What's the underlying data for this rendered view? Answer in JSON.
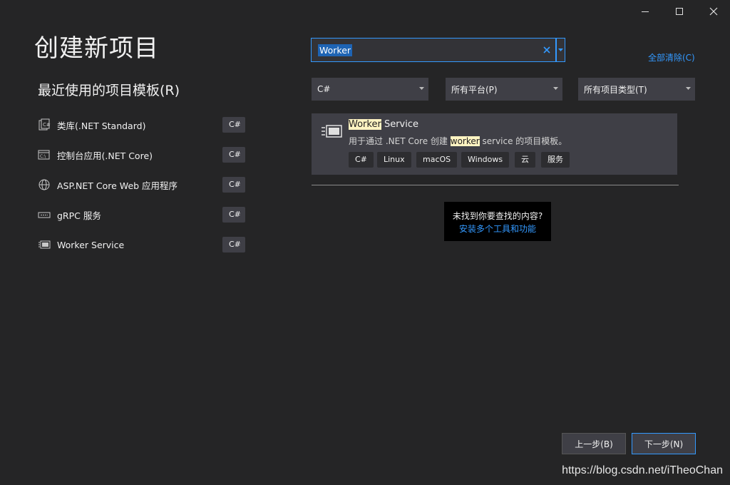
{
  "window": {
    "controls": [
      "minimize-icon",
      "maximize-icon",
      "close-icon"
    ]
  },
  "page_title": "创建新项目",
  "recent": {
    "title": "最近使用的项目模板(R)",
    "items": [
      {
        "label": "类库(.NET Standard)",
        "lang": "C#",
        "icon": "class-library-icon"
      },
      {
        "label": "控制台应用(.NET Core)",
        "lang": "C#",
        "icon": "console-app-icon"
      },
      {
        "label": "ASP.NET Core Web 应用程序",
        "lang": "C#",
        "icon": "web-globe-icon"
      },
      {
        "label": "gRPC 服务",
        "lang": "C#",
        "icon": "grpc-service-icon"
      },
      {
        "label": "Worker Service",
        "lang": "C#",
        "icon": "worker-service-icon"
      }
    ]
  },
  "search": {
    "value": "Worker",
    "clear_icon": "clear-search-icon"
  },
  "clear_all": "全部清除(C)",
  "filters": {
    "language": "C#",
    "platform": "所有平台(P)",
    "project_type": "所有项目类型(T)"
  },
  "result": {
    "title_highlight": "Worker",
    "title_rest": " Service",
    "desc_before": "用于通过 .NET Core 创建 ",
    "desc_highlight": "worker",
    "desc_after": " service 的项目模板。",
    "tags": [
      "C#",
      "Linux",
      "macOS",
      "Windows",
      "云",
      "服务"
    ]
  },
  "not_found": {
    "question": "未找到你要查找的内容?",
    "link": "安装多个工具和功能"
  },
  "buttons": {
    "back": "上一步(B)",
    "next": "下一步(N)"
  },
  "watermark": "https://blog.csdn.net/iTheoChan",
  "colors": {
    "background": "#252526",
    "panel": "#3f3f46",
    "accent": "#3399ff",
    "highlight": "#fff4c2"
  }
}
